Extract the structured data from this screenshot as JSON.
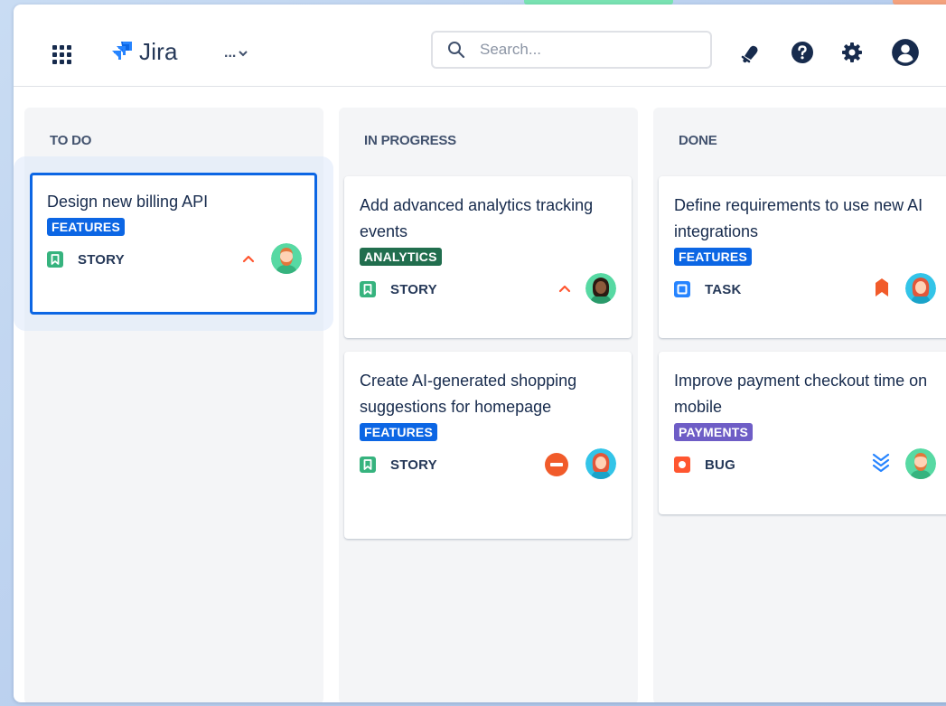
{
  "header": {
    "app_name": "Jira",
    "more_label": "...",
    "search_placeholder": "Search..."
  },
  "icons": {
    "apps": "grid-icon",
    "logo": "jira-logo-icon",
    "more": "chevron-down-icon",
    "search": "search-icon",
    "notifications": "bell-icon",
    "help": "help-icon",
    "settings": "gear-icon",
    "profile": "user-avatar-icon"
  },
  "columns": [
    {
      "title": "TO DO",
      "cards": [
        {
          "title": "Design new billing API",
          "label": "FEATURES",
          "type": "STORY",
          "priority": "high",
          "assignee": "bearded-man"
        }
      ]
    },
    {
      "title": "IN PROGRESS",
      "cards": [
        {
          "title": "Add advanced analytics tracking events",
          "label": "ANALYTICS",
          "type": "STORY",
          "priority": "high",
          "assignee": "dark-hair-woman"
        },
        {
          "title": "Create AI-generated shopping suggestions for homepage",
          "label": "FEATURES",
          "type": "STORY",
          "priority": "blocker",
          "assignee": "red-hair-woman"
        }
      ]
    },
    {
      "title": "DONE",
      "cards": [
        {
          "title": "Define requirements to use new AI integrations",
          "label": "FEATURES",
          "type": "TASK",
          "priority": "highest",
          "assignee": "red-hair-woman"
        },
        {
          "title": "Improve payment checkout time on mobile",
          "label": "PAYMENTS",
          "type": "BUG",
          "priority": "lowest",
          "assignee": "bearded-man"
        }
      ]
    }
  ],
  "colors": {
    "brand_blue": "#0c66e4",
    "story_green": "#36b37e",
    "task_blue": "#2684ff",
    "bug_red": "#ff5630",
    "priority_orange": "#ff5630",
    "label_analytics": "#216e4e",
    "label_payments": "#6e5dc6"
  }
}
